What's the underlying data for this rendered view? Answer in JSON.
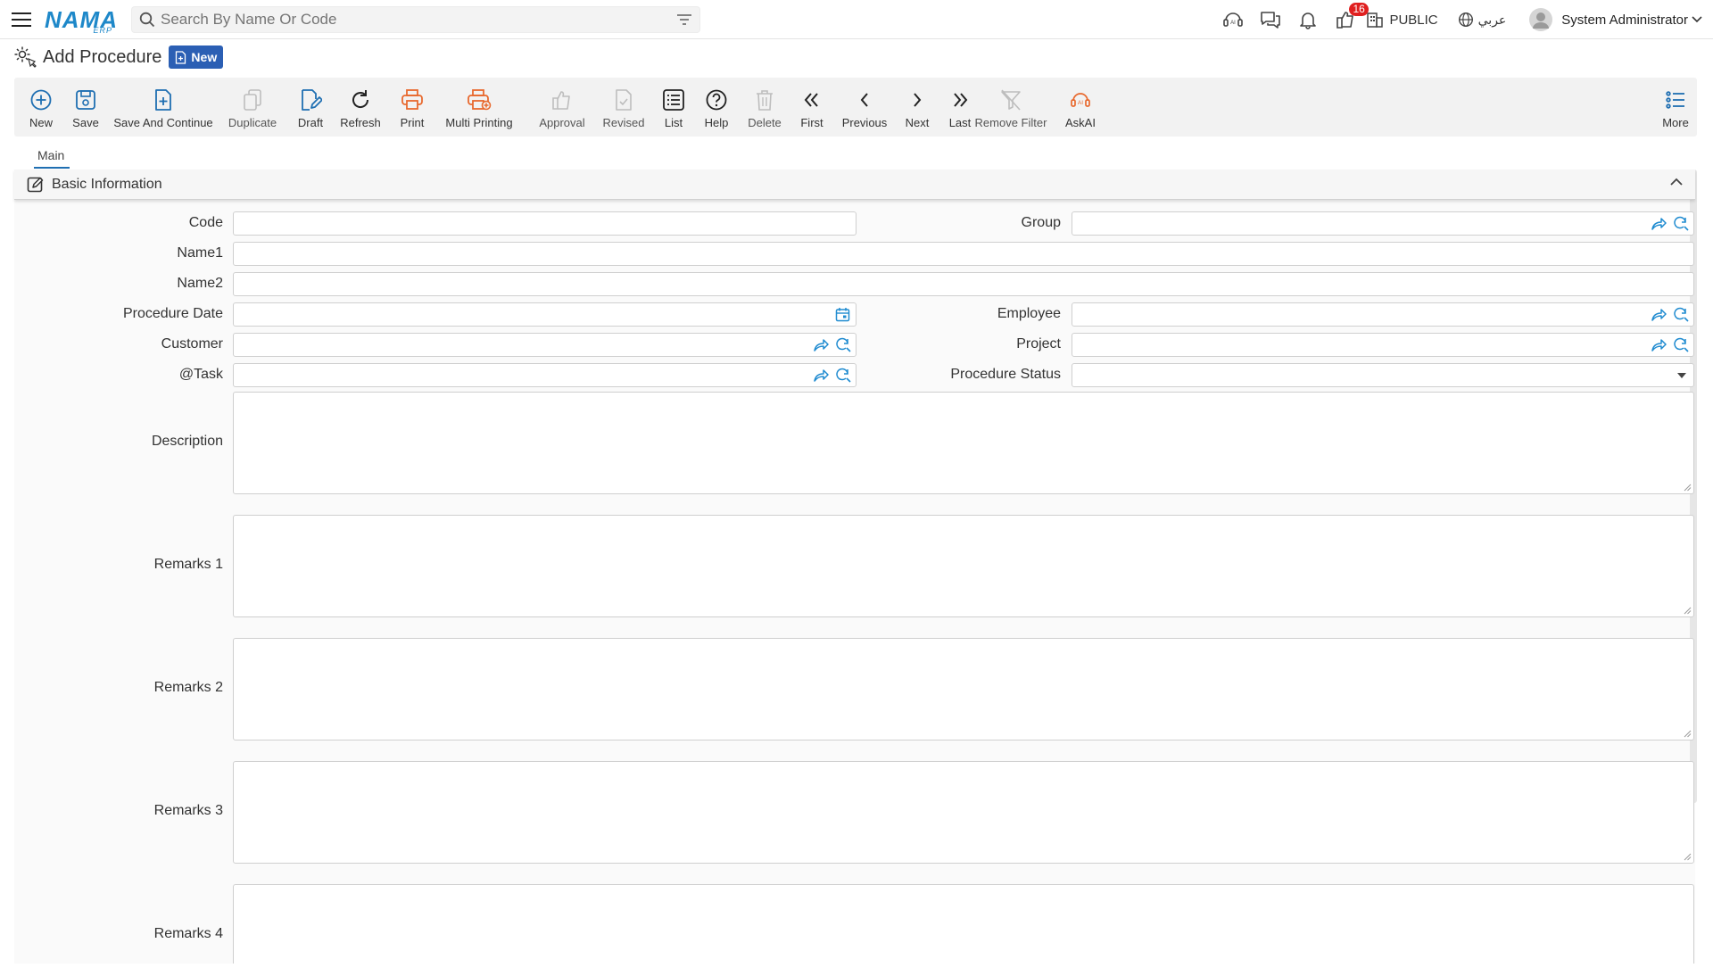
{
  "app": {
    "logo_text": "NAMA",
    "logo_sub": "ERP"
  },
  "search": {
    "placeholder": "Search By Name Or Code",
    "value": ""
  },
  "topbar": {
    "notification_count": "16",
    "public_label": "PUBLIC",
    "language_label": "عربي",
    "user_name": "System Administrator"
  },
  "page": {
    "title": "Add Procedure",
    "status_badge": "New"
  },
  "toolbar": {
    "new": "New",
    "save": "Save",
    "save_and_continue": "Save And Continue",
    "duplicate": "Duplicate",
    "draft": "Draft",
    "refresh": "Refresh",
    "print": "Print",
    "multi_printing": "Multi Printing",
    "approval": "Approval",
    "revised": "Revised",
    "list": "List",
    "help": "Help",
    "delete": "Delete",
    "first": "First",
    "previous": "Previous",
    "next": "Next",
    "last": "Last",
    "remove_filter": "Remove Filter",
    "askai": "AskAI",
    "more": "More"
  },
  "tabs": {
    "main": "Main"
  },
  "section": {
    "title": "Basic Information"
  },
  "form": {
    "code": {
      "label": "Code",
      "value": ""
    },
    "group": {
      "label": "Group",
      "value": ""
    },
    "name1": {
      "label": "Name1",
      "value": ""
    },
    "name2": {
      "label": "Name2",
      "value": ""
    },
    "procedure_date": {
      "label": "Procedure Date",
      "value": ""
    },
    "employee": {
      "label": "Employee",
      "value": ""
    },
    "customer": {
      "label": "Customer",
      "value": ""
    },
    "project": {
      "label": "Project",
      "value": ""
    },
    "task": {
      "label": "@Task",
      "value": ""
    },
    "procedure_status": {
      "label": "Procedure Status",
      "value": ""
    },
    "description": {
      "label": "Description",
      "value": ""
    },
    "remarks1": {
      "label": "Remarks 1",
      "value": ""
    },
    "remarks2": {
      "label": "Remarks 2",
      "value": ""
    },
    "remarks3": {
      "label": "Remarks 3",
      "value": ""
    },
    "remarks4": {
      "label": "Remarks 4",
      "value": ""
    }
  },
  "colors": {
    "accent_blue": "#1f6fb2",
    "print_orange": "#e8692e",
    "badge_red": "#e02020",
    "new_badge": "#2b5fb4"
  }
}
